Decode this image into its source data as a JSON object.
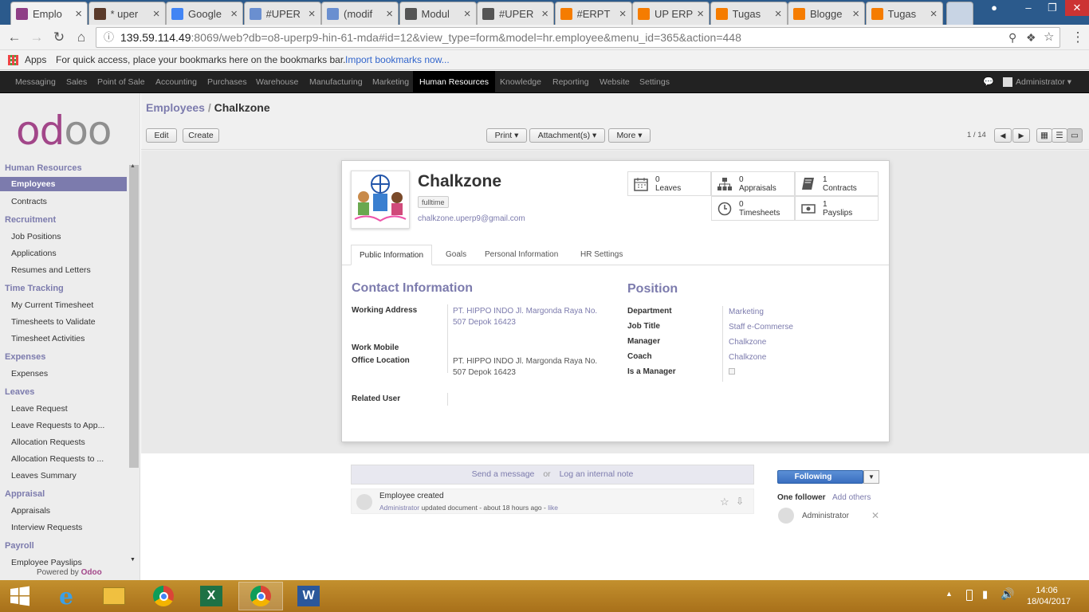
{
  "browser": {
    "tabs": [
      {
        "label": "Emplo",
        "color": "#8f3f86",
        "active": true
      },
      {
        "label": "* uper",
        "color": "#5a3a2a"
      },
      {
        "label": "Google",
        "color": "#4285f4"
      },
      {
        "label": "#UPER",
        "color": "#6a8fd0"
      },
      {
        "label": "(modif",
        "color": "#6a8fd0"
      },
      {
        "label": "Modul",
        "color": "#555"
      },
      {
        "label": "#UPER",
        "color": "#555"
      },
      {
        "label": "#ERPT",
        "color": "#f57c00"
      },
      {
        "label": "UP ERP",
        "color": "#f57c00"
      },
      {
        "label": "Tugas",
        "color": "#f57c00"
      },
      {
        "label": "Blogge",
        "color": "#f57c00"
      },
      {
        "label": "Tugas",
        "color": "#f57c00"
      }
    ],
    "url_host": "139.59.114.49",
    "url_path": ":8069/web?db=o8-uperp9-hin-61-mda#id=12&view_type=form&model=hr.employee&menu_id=365&action=448",
    "apps_label": "Apps",
    "bookmarks_text": "For quick access, place your bookmarks here on the bookmarks bar.",
    "import_link": "Import bookmarks now..."
  },
  "topmenu": {
    "items": [
      "Messaging",
      "Sales",
      "Point of Sale",
      "Accounting",
      "Purchases",
      "Warehouse",
      "Manufacturing",
      "Marketing",
      "Human Resources",
      "Knowledge",
      "Reporting",
      "Website",
      "Settings"
    ],
    "active": "Human Resources",
    "user": "Administrator"
  },
  "sidebar": {
    "logo_o": "o",
    "logo_d": "d",
    "logo_oo": "oo",
    "sections": [
      {
        "title": "Human Resources",
        "items": [
          "Employees",
          "Contracts"
        ]
      },
      {
        "title": "Recruitment",
        "items": [
          "Job Positions",
          "Applications",
          "Resumes and Letters"
        ]
      },
      {
        "title": "Time Tracking",
        "items": [
          "My Current Timesheet",
          "Timesheets to Validate",
          "Timesheet Activities"
        ]
      },
      {
        "title": "Expenses",
        "items": [
          "Expenses"
        ]
      },
      {
        "title": "Leaves",
        "items": [
          "Leave Request",
          "Leave Requests to App...",
          "Allocation Requests",
          "Allocation Requests to ...",
          "Leaves Summary"
        ]
      },
      {
        "title": "Appraisal",
        "items": [
          "Appraisals",
          "Interview Requests"
        ]
      },
      {
        "title": "Payroll",
        "items": [
          "Employee Payslips"
        ]
      }
    ],
    "active_item": "Employees",
    "powered_by": "Powered by ",
    "powered_brand": "Odoo"
  },
  "view": {
    "breadcrumb_root": "Employees",
    "breadcrumb_sep": " / ",
    "breadcrumb_current": "Chalkzone",
    "edit": "Edit",
    "create": "Create",
    "print": "Print ▾",
    "attachments": "Attachment(s) ▾",
    "more": "More ▾",
    "pager": "1 / 14"
  },
  "employee": {
    "name": "Chalkzone",
    "tag": "fulltime",
    "email": "chalkzone.uperp9@gmail.com",
    "stats": [
      {
        "count": "0",
        "label": "Leaves",
        "icon": "calendar-icon"
      },
      {
        "count": "0",
        "label": "Appraisals",
        "icon": "org-chart-icon"
      },
      {
        "count": "1",
        "label": "Contracts",
        "icon": "book-icon"
      },
      {
        "count": "0",
        "label": "Timesheets",
        "icon": "clock-icon"
      },
      {
        "count": "1",
        "label": "Payslips",
        "icon": "money-icon"
      }
    ],
    "tabs": [
      "Public Information",
      "Goals",
      "Personal Information",
      "HR Settings"
    ],
    "contact_title": "Contact Information",
    "working_address_label": "Working Address",
    "working_address": "PT. HIPPO INDO Jl. Margonda Raya No. 507 Depok 16423",
    "work_mobile_label": "Work Mobile",
    "office_location_label": "Office Location",
    "office_location": "PT. HIPPO INDO Jl. Margonda Raya No. 507 Depok 16423",
    "related_user_label": "Related User",
    "position_title": "Position",
    "department_label": "Department",
    "department": "Marketing",
    "job_title_label": "Job Title",
    "job_title": "Staff e-Commerse",
    "manager_label": "Manager",
    "manager": "Chalkzone",
    "coach_label": "Coach",
    "coach": "Chalkzone",
    "is_manager_label": "Is a Manager"
  },
  "chatter": {
    "send_message": "Send a message",
    "or": "or",
    "log_note": "Log an internal note",
    "msg_title": "Employee created",
    "msg_author": "Administrator",
    "msg_body": " updated document - about 18 hours ago - ",
    "msg_like": "like",
    "following": "Following",
    "followers": "One follower",
    "add_others": "Add others",
    "follower_name": "Administrator"
  },
  "taskbar": {
    "time": "14:06",
    "date": "18/04/2017"
  }
}
